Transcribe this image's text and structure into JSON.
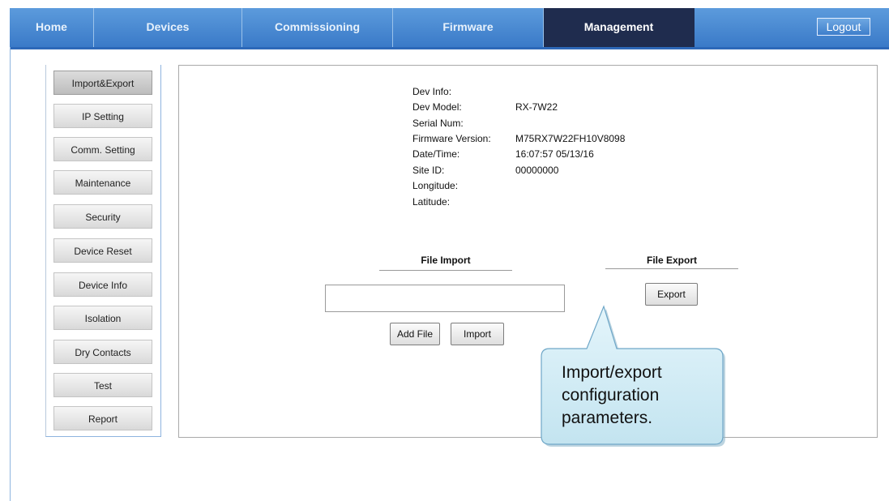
{
  "nav": {
    "tabs": [
      {
        "label": "Home"
      },
      {
        "label": "Devices"
      },
      {
        "label": "Commissioning"
      },
      {
        "label": "Firmware"
      },
      {
        "label": "Management"
      }
    ],
    "active_tab": "Management",
    "logout_label": "Logout"
  },
  "sidebar": {
    "items": [
      {
        "label": "Import&Export"
      },
      {
        "label": "IP Setting"
      },
      {
        "label": "Comm. Setting"
      },
      {
        "label": "Maintenance"
      },
      {
        "label": "Security"
      },
      {
        "label": "Device Reset"
      },
      {
        "label": "Device Info"
      },
      {
        "label": "Isolation"
      },
      {
        "label": "Dry Contacts"
      },
      {
        "label": "Test"
      },
      {
        "label": "Report"
      }
    ],
    "active_item": "Import&Export"
  },
  "dev_info": {
    "header": "Dev Info:",
    "fields": [
      {
        "label": "Dev Model:",
        "value": "RX-7W22"
      },
      {
        "label": "Serial Num:",
        "value": ""
      },
      {
        "label": "Firmware Version:",
        "value": "M75RX7W22FH10V8098"
      },
      {
        "label": "Date/Time:",
        "value": "16:07:57 05/13/16"
      },
      {
        "label": "Site ID:",
        "value": "00000000"
      },
      {
        "label": "Longitude:",
        "value": ""
      },
      {
        "label": "Latitude:",
        "value": ""
      }
    ]
  },
  "file_import": {
    "title": "File Import",
    "file_value": "",
    "add_file_label": "Add File",
    "import_label": "Import"
  },
  "file_export": {
    "title": "File Export",
    "export_label": "Export"
  },
  "callout": {
    "line1": "Import/export",
    "line2": "configuration",
    "line3": "parameters."
  },
  "colors": {
    "nav_bg": "#3a7ac8",
    "nav_active": "#1f2c4e",
    "callout_fill": "#cfeaf3",
    "callout_border": "#6fa7c8"
  }
}
